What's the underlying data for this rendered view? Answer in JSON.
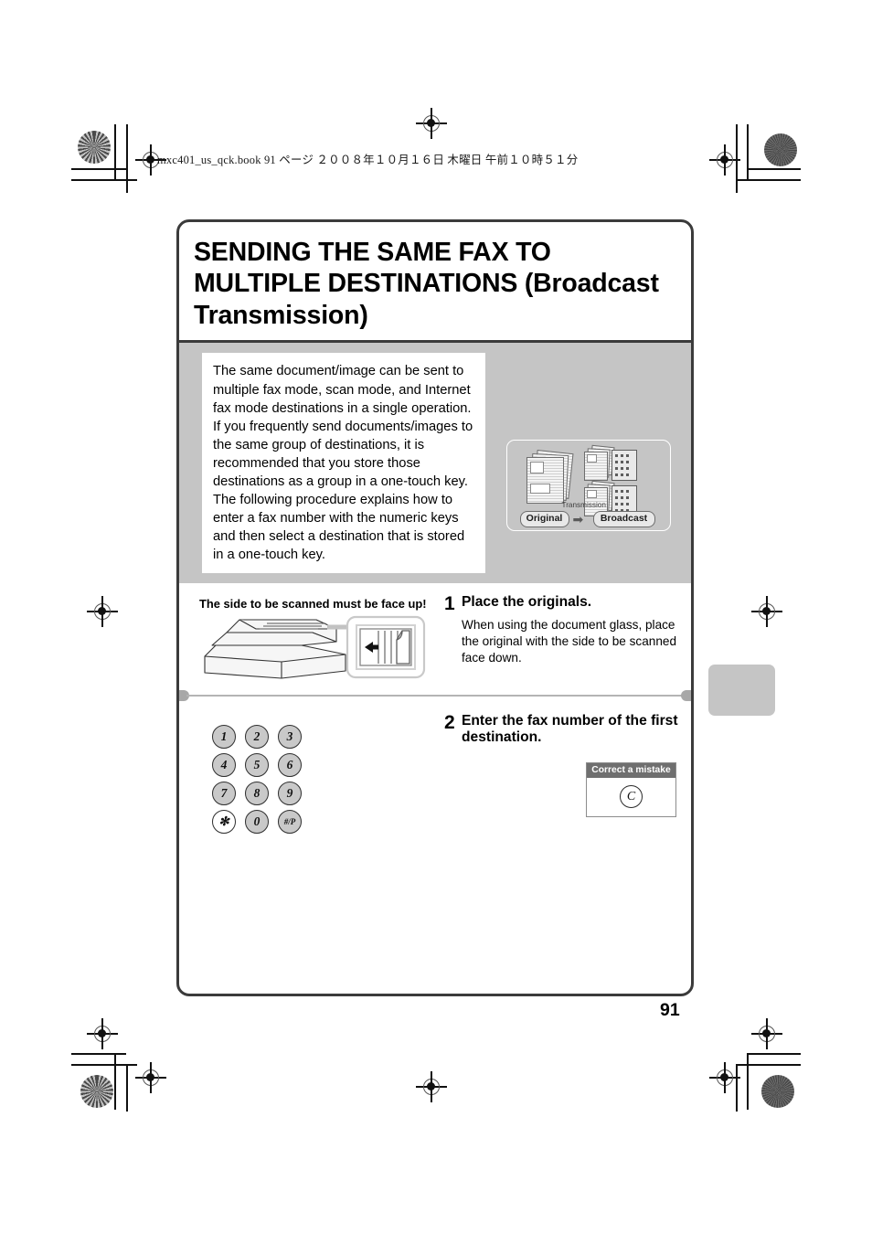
{
  "header": {
    "book_line": "mxc401_us_qck.book   91 ページ   ２００８年１０月１６日   木曜日   午前１０時５１分"
  },
  "title": "SENDING THE SAME FAX TO MULTIPLE DESTINATIONS (Broadcast Transmission)",
  "intro": {
    "text": "The same document/image can be sent to multiple fax mode, scan mode, and Internet fax mode destinations in a single operation. If you frequently send documents/images to the same group of destinations, it is recommended that you store those destinations as a group in a one-touch key. The following procedure explains how to enter a fax number with the numeric keys and then select a destination that is stored in a one-touch key.",
    "illustration": {
      "original_label": "Original",
      "transmission_label": "Transmission",
      "broadcast_label": "Broadcast",
      "arrow_glyph": "➡"
    }
  },
  "steps": [
    {
      "number": "1",
      "title": "Place the originals.",
      "body": "When using the document glass, place the original with the side to be scanned face down.",
      "note": "The side to be scanned must be face up!"
    },
    {
      "number": "2",
      "title": "Enter the fax number of the first destination.",
      "body": "",
      "note": ""
    }
  ],
  "keypad": {
    "keys": [
      "1",
      "2",
      "3",
      "4",
      "5",
      "6",
      "7",
      "8",
      "9",
      "✻",
      "0",
      "#/P"
    ]
  },
  "correct_mistake": {
    "header": "Correct a mistake",
    "key_label": "C"
  },
  "page_number": "91",
  "colors": {
    "gray_band": "#c5c5c5",
    "frame": "#3b3b3b",
    "callout_header": "#6f6f6f"
  }
}
